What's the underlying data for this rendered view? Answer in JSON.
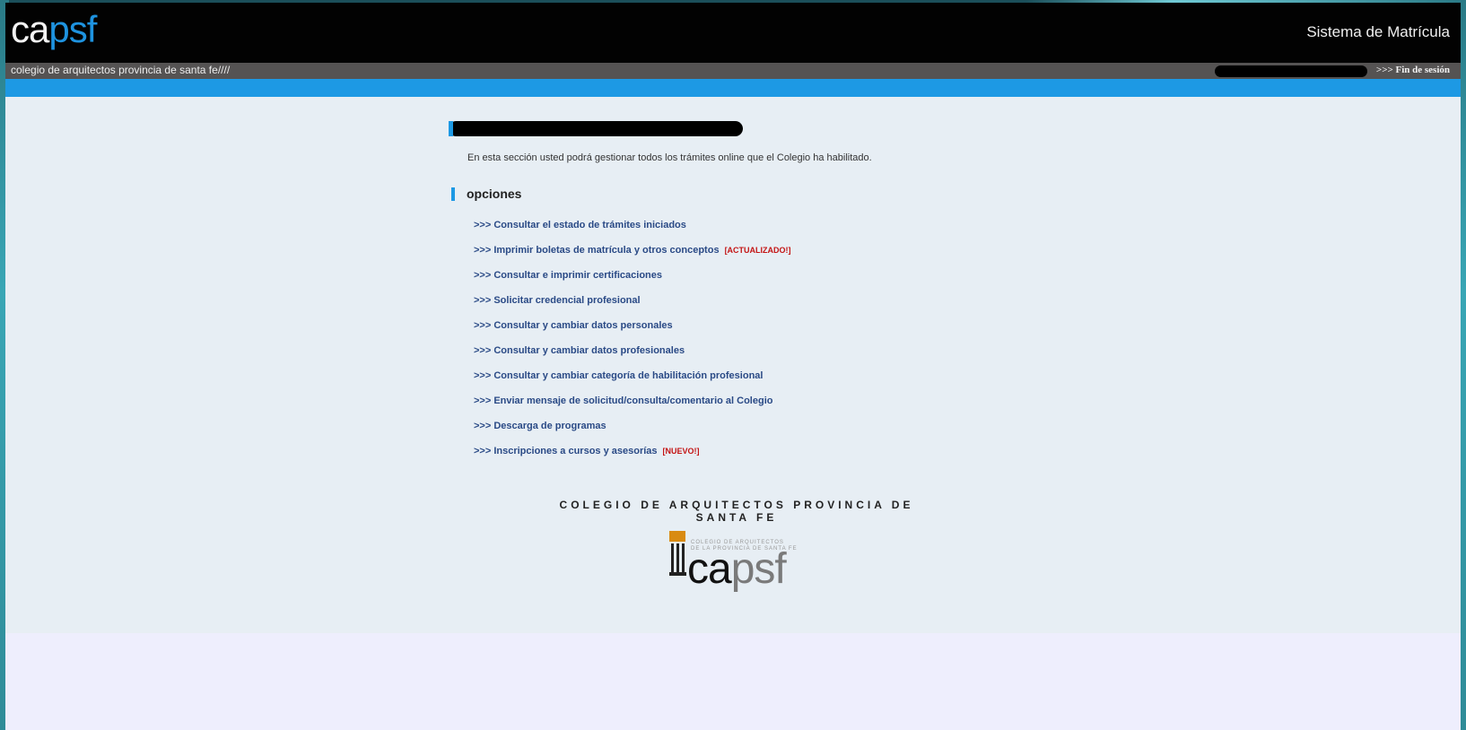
{
  "header": {
    "logo_ca": "ca",
    "logo_psf": "psf",
    "system_title": "Sistema de Matrícula"
  },
  "subbar": {
    "org_text": "colegio de arquitectos provincia de santa fe////",
    "logout_label": ">>> Fin de sesión"
  },
  "content": {
    "intro": "En esta sección usted podrá gestionar todos los trámites online que el Colegio ha habilitado.",
    "section_title": "opciones",
    "menu": [
      {
        "label": ">>> Consultar el estado de trámites iniciados",
        "tag": ""
      },
      {
        "label": ">>> Imprimir boletas de matrícula y otros conceptos",
        "tag": "[ACTUALIZADO!]"
      },
      {
        "label": ">>> Consultar e imprimir certificaciones",
        "tag": ""
      },
      {
        "label": ">>> Solicitar credencial profesional",
        "tag": ""
      },
      {
        "label": ">>> Consultar y cambiar datos personales",
        "tag": ""
      },
      {
        "label": ">>> Consultar y cambiar datos profesionales",
        "tag": ""
      },
      {
        "label": ">>> Consultar y cambiar categoría de habilitación profesional",
        "tag": ""
      },
      {
        "label": ">>> Enviar mensaje de solicitud/consulta/comentario al Colegio",
        "tag": ""
      },
      {
        "label": ">>> Descarga de programas",
        "tag": ""
      },
      {
        "label": ">>> Inscripciones a cursos y asesorías",
        "tag": "[NUEVO!]"
      }
    ]
  },
  "footer": {
    "title": "COLEGIO DE ARQUITECTOS PROVINCIA DE SANTA FE",
    "logo_small_1": "COLEGIO DE ARQUITECTOS",
    "logo_small_2": "DE LA PROVINCIA DE SANTA FE",
    "logo_ca": "ca",
    "logo_psf": "psf"
  },
  "colors": {
    "accent_blue": "#1d99e4",
    "link": "#2a4a86",
    "tag_red": "#c41414",
    "header_bg": "#020202"
  }
}
